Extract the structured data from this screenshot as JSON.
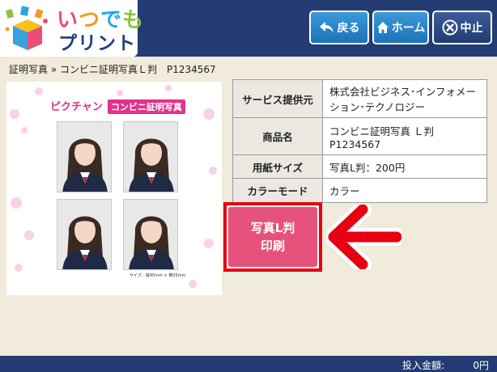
{
  "logo": {
    "line1": [
      "い",
      "つ",
      "で",
      "も"
    ],
    "line2": "プリント"
  },
  "header": {
    "back_label": "戻る",
    "home_label": "ホーム",
    "cancel_label": "中止"
  },
  "breadcrumb": "証明写真 » コンビニ証明写真Ｌ判　P1234567",
  "preview": {
    "brand": "ピクチャン",
    "title": "コンビニ証明写真",
    "size_note": "サイズ：縦45mm × 横35mm"
  },
  "info": [
    {
      "key": "サービス提供元",
      "value": "株式会社ビジネス･インフォメーション･テクノロジー"
    },
    {
      "key": "商品名",
      "value": "コンビニ証明写真 Ｌ判 P1234567"
    },
    {
      "key": "用紙サイズ",
      "value": "写真L判：200円"
    },
    {
      "key": "カラーモード",
      "value": "カラー"
    }
  ],
  "print_button": {
    "line1": "写真L判",
    "line2": "印刷"
  },
  "footer": {
    "amount_label": "投入金額:",
    "amount_value": "0円"
  },
  "colors": {
    "header_bg": "#243b73",
    "page_bg": "#f1ebdb",
    "button_blue": "#1c73b8",
    "print_pink": "#e6527c",
    "highlight_red": "#e60012"
  },
  "icons": [
    "back-arrow-icon",
    "home-icon",
    "cancel-x-icon",
    "cube-logo-icon",
    "pointer-arrow-icon"
  ]
}
